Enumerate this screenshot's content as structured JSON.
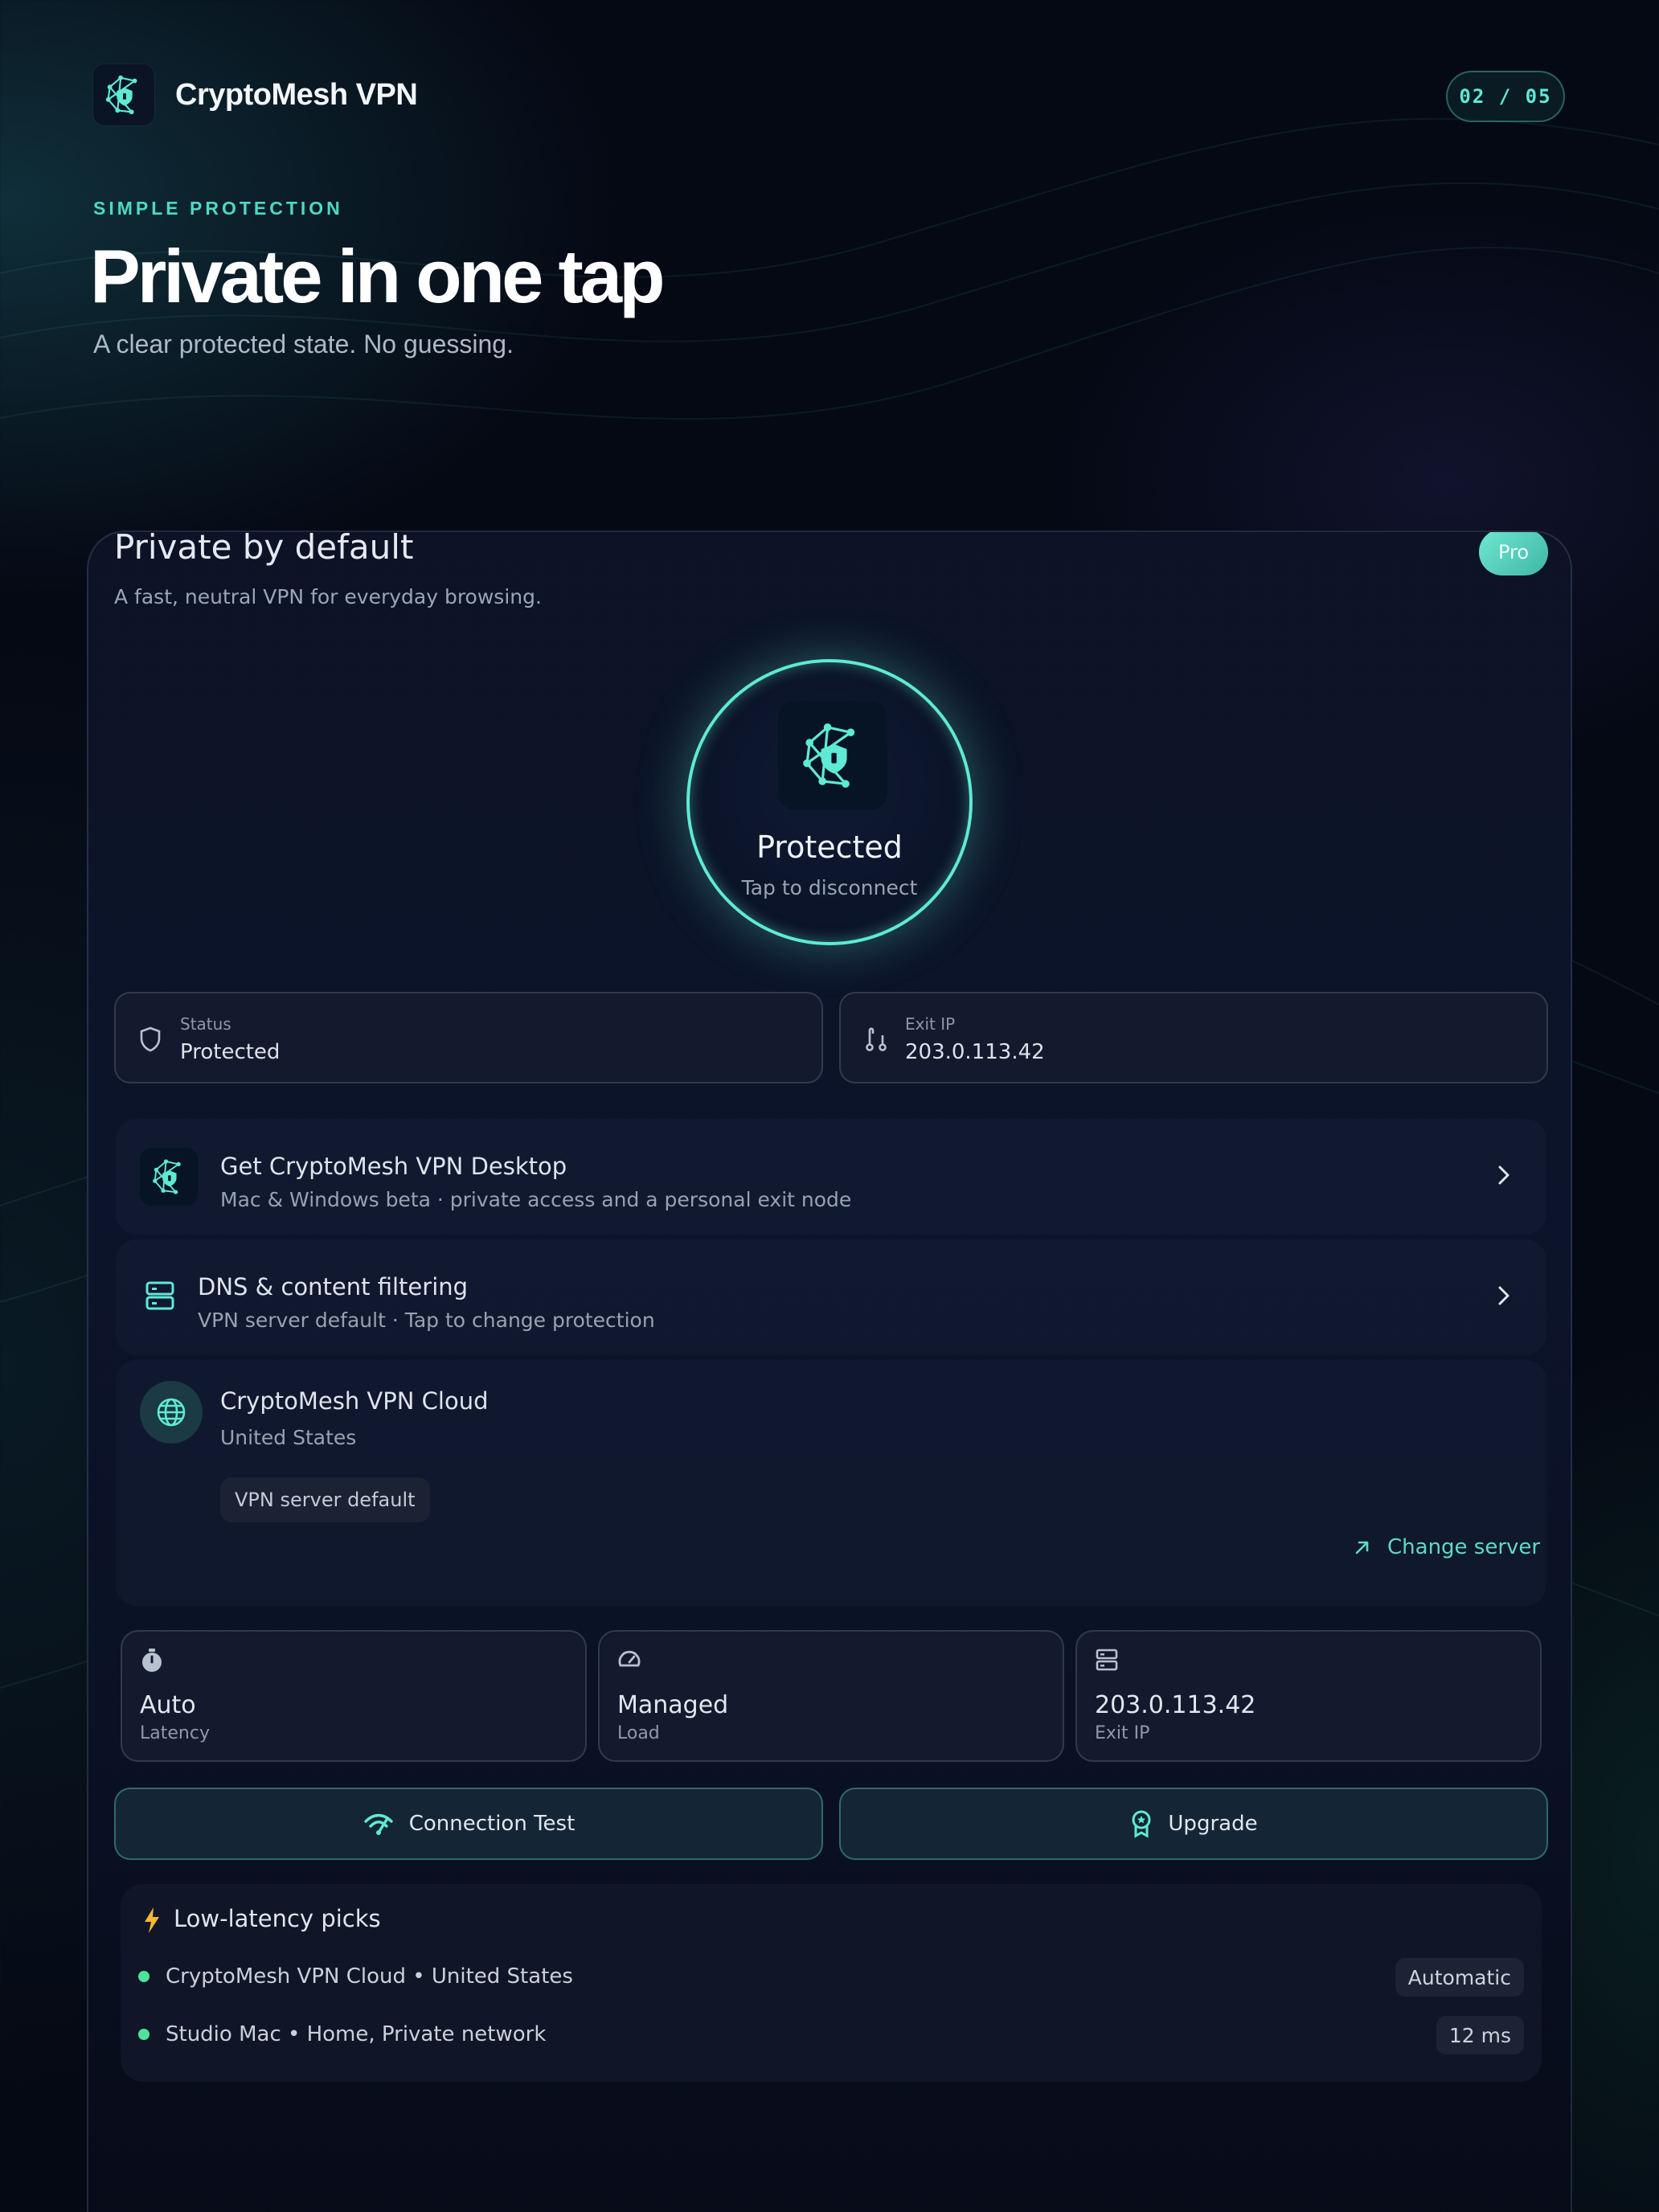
{
  "header": {
    "app_name": "CryptoMesh VPN",
    "step_indicator": "02 / 05"
  },
  "hero": {
    "eyebrow": "SIMPLE PROTECTION",
    "title": "Private in one tap",
    "subtitle": "A clear protected state. No guessing."
  },
  "card": {
    "title": "Private by default",
    "badge": "Pro",
    "subtitle": "A fast, neutral VPN for everyday browsing."
  },
  "connect_button": {
    "state": "Protected",
    "hint": "Tap to disconnect"
  },
  "status_boxes": [
    {
      "label": "Status",
      "value": "Protected"
    },
    {
      "label": "Exit IP",
      "value": "203.0.113.42"
    }
  ],
  "desktop_promo": {
    "title": "Get CryptoMesh VPN Desktop",
    "subtitle": "Mac & Windows beta · private access and a personal exit node"
  },
  "dns": {
    "title": "DNS & content filtering",
    "subtitle": "VPN server default · Tap to change protection"
  },
  "server": {
    "name": "CryptoMesh VPN Cloud",
    "location": "United States",
    "chip": "VPN server default",
    "change_label": "Change server"
  },
  "stats": [
    {
      "icon": "stopwatch-icon",
      "value": "Auto",
      "label": "Latency"
    },
    {
      "icon": "gauge-icon",
      "value": "Managed",
      "label": "Load"
    },
    {
      "icon": "server-icon",
      "value": "203.0.113.42",
      "label": "Exit IP"
    }
  ],
  "actions": {
    "connection_test": "Connection Test",
    "upgrade": "Upgrade"
  },
  "picks": {
    "title": "Low-latency picks",
    "items": [
      {
        "label": "CryptoMesh VPN Cloud • United States",
        "tag": "Automatic"
      },
      {
        "label": "Studio Mac • Home, Private network",
        "tag": "12 ms"
      }
    ]
  },
  "colors": {
    "accent": "#5eead4",
    "background": "#050914",
    "card": "#0c1326",
    "online_dot": "#4ee39a",
    "bolt": "#f5b82e"
  }
}
